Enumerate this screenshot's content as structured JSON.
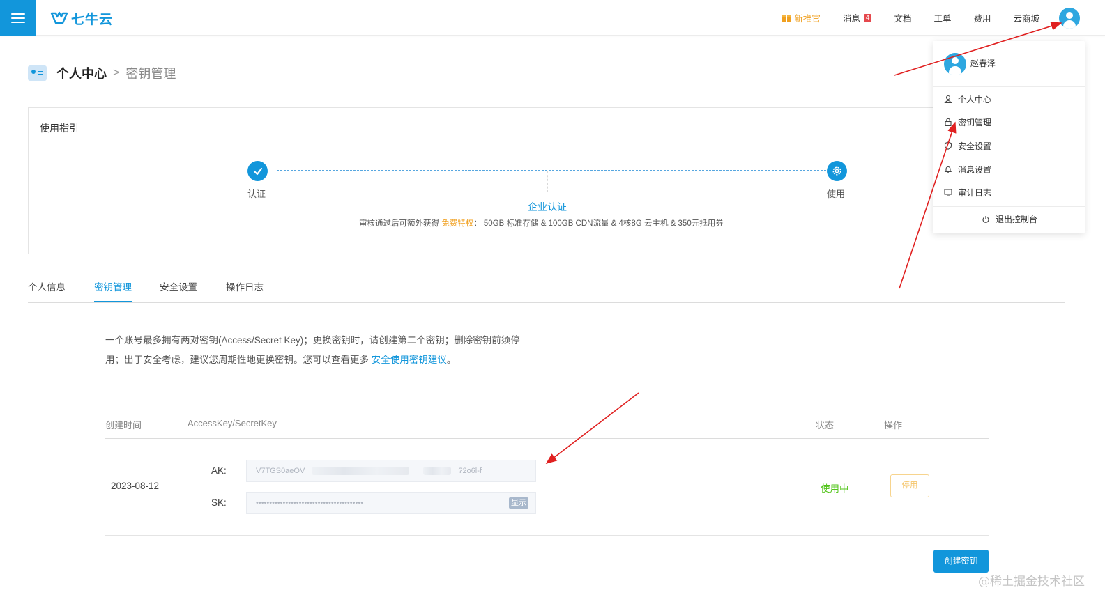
{
  "topbar": {
    "logo_text": "七牛云",
    "nav": {
      "new_offer": "新推官",
      "messages": "消息",
      "message_count": "4",
      "docs": "文档",
      "tickets": "工单",
      "billing": "费用",
      "marketplace": "云商城"
    }
  },
  "breadcrumb": {
    "root": "个人中心",
    "separator": ">",
    "current": "密钥管理"
  },
  "guide": {
    "title": "使用指引",
    "step1_label": "认证",
    "step2_label": "使用",
    "enterprise_link": "企业认证",
    "desc_prefix": "审核通过后可额外获得 ",
    "desc_highlight": "免费特权",
    "desc_suffix": "：  50GB 标准存储 & 100GB CDN流量 & 4核8G 云主机 & 350元抵用券"
  },
  "tabs": [
    "个人信息",
    "密钥管理",
    "安全设置",
    "操作日志"
  ],
  "notice": {
    "line1": "一个账号最多拥有两对密钥(Access/Secret Key)；更换密钥时，请创建第二个密钥；删除密钥前须停",
    "line2_prefix": "用；出于安全考虑，建议您周期性地更换密钥。您可以查看更多 ",
    "link": "安全使用密钥建议",
    "line2_suffix": "。"
  },
  "key_table": {
    "headers": {
      "created": "创建时间",
      "keys": "AccessKey/SecretKey",
      "status": "状态",
      "actions": "操作"
    },
    "rows": [
      {
        "date": "2023-08-12",
        "ak_label": "AK:",
        "ak_prefix": "V7TGS0aeOV",
        "ak_suffix": "?2o6l-f",
        "sk_label": "SK:",
        "sk_masked": "••••••••••••••••••••••••••••••••••••••••",
        "show_label": "显示",
        "status": "使用中",
        "disable_label": "停用"
      }
    ]
  },
  "create_button": "创建密钥",
  "dropdown": {
    "username": "赵春泽",
    "items": [
      "个人中心",
      "密钥管理",
      "安全设置",
      "消息设置",
      "审计日志"
    ],
    "logout": "退出控制台"
  },
  "watermark": "@稀土掘金技术社区",
  "colors": {
    "brand": "#1296db",
    "accent_orange": "#f0a020",
    "status_green": "#52c41a",
    "annotation_red": "#e02020"
  }
}
